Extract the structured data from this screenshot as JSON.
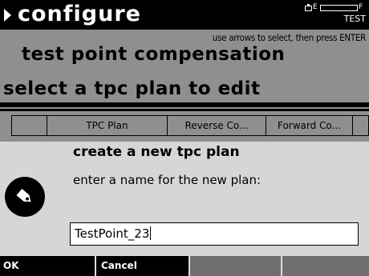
{
  "header": {
    "app_title": "configure",
    "battery_empty": "E",
    "battery_full": "F",
    "mode": "TEST"
  },
  "hint": "use arrows to select, then press ENTER",
  "screen_title": "test point compensation",
  "section_title": "select a tpc plan to edit",
  "table": {
    "columns": [
      "",
      "TPC Plan",
      "Reverse Co...",
      "Forward Co...",
      ""
    ]
  },
  "dialog": {
    "title": "create a new tpc plan",
    "prompt": "enter a name for the new plan:",
    "name_value": "TestPoint_23",
    "icon": "tag-icon"
  },
  "softkeys": {
    "ok_label": "OK",
    "cancel_label": "Cancel",
    "key3_label": "",
    "key4_label": "",
    "key5_label": ""
  }
}
